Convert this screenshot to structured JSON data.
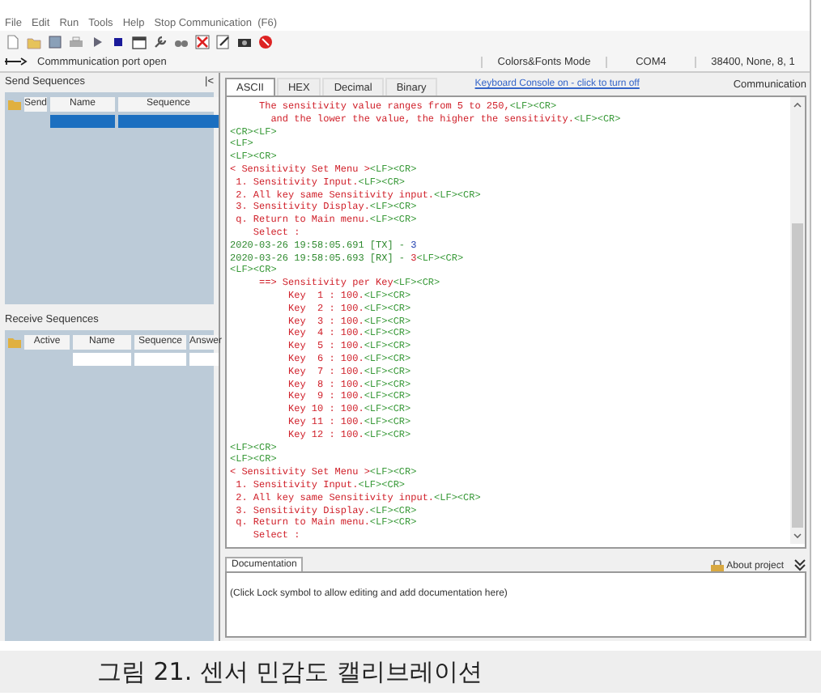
{
  "menu": [
    "File",
    "Edit",
    "Run",
    "Tools",
    "Help",
    "Stop Communication  (F6)"
  ],
  "status": {
    "port": "Commmunication port open",
    "mode": "Colors&Fonts Mode",
    "com": "COM4",
    "settings": "38400, None, 8, 1"
  },
  "send_sequences": {
    "title": "Send Sequences",
    "collapse": "|<",
    "columns": [
      "Send",
      "Name",
      "Sequence"
    ],
    "rows": [
      {
        "selected": true
      }
    ]
  },
  "receive_sequences": {
    "title": "Receive Sequences",
    "columns": [
      "Active",
      "Name",
      "Sequence",
      "Answer"
    ],
    "rows": [
      {
        "selected": false
      }
    ]
  },
  "console_tabs": [
    {
      "label": "ASCII",
      "selected": true
    },
    {
      "label": "HEX",
      "selected": false
    },
    {
      "label": "Decimal",
      "selected": false
    },
    {
      "label": "Binary",
      "selected": false
    }
  ],
  "keyboard_link": "Keyboard Console on - click to turn off",
  "panel_label": "Communication",
  "console_lines": [
    {
      "segments": [
        {
          "kind": "msg",
          "text": "     The sensitivity value ranges from 5 to 250,"
        },
        {
          "kind": "ctl",
          "text": "<LF><CR>"
        }
      ]
    },
    {
      "segments": [
        {
          "kind": "msg",
          "text": "       and the lower the value, the higher the sensitivity."
        },
        {
          "kind": "ctl",
          "text": "<LF><CR>"
        }
      ]
    },
    {
      "segments": [
        {
          "kind": "ctl",
          "text": "<CR><LF>"
        }
      ]
    },
    {
      "segments": [
        {
          "kind": "ctl",
          "text": "<LF>"
        }
      ]
    },
    {
      "segments": [
        {
          "kind": "ctl",
          "text": "<LF><CR>"
        }
      ]
    },
    {
      "segments": [
        {
          "kind": "msg",
          "text": "< Sensitivity Set Menu >"
        },
        {
          "kind": "ctl",
          "text": "<LF><CR>"
        }
      ]
    },
    {
      "segments": [
        {
          "kind": "msg",
          "text": " 1. Sensitivity Input."
        },
        {
          "kind": "ctl",
          "text": "<LF><CR>"
        }
      ]
    },
    {
      "segments": [
        {
          "kind": "msg",
          "text": " 2. All key same Sensitivity input."
        },
        {
          "kind": "ctl",
          "text": "<LF><CR>"
        }
      ]
    },
    {
      "segments": [
        {
          "kind": "msg",
          "text": " 3. Sensitivity Display."
        },
        {
          "kind": "ctl",
          "text": "<LF><CR>"
        }
      ]
    },
    {
      "segments": [
        {
          "kind": "msg",
          "text": " q. Return to Main menu."
        },
        {
          "kind": "ctl",
          "text": "<LF><CR>"
        }
      ]
    },
    {
      "segments": [
        {
          "kind": "msg",
          "text": "    Select :"
        }
      ]
    },
    {
      "segments": [
        {
          "kind": "ts",
          "text": "2020-03-26 19:58:05.691 [TX] - "
        },
        {
          "kind": "val",
          "text": "3"
        }
      ]
    },
    {
      "segments": [
        {
          "kind": "ts",
          "text": "2020-03-26 19:58:05.693 [RX] - "
        },
        {
          "kind": "msg",
          "text": "3"
        },
        {
          "kind": "ctl",
          "text": "<LF><CR>"
        }
      ]
    },
    {
      "segments": [
        {
          "kind": "ctl",
          "text": "<LF><CR>"
        }
      ]
    },
    {
      "segments": [
        {
          "kind": "msg",
          "text": "     ==> Sensitivity per Key"
        },
        {
          "kind": "ctl",
          "text": "<LF><CR>"
        }
      ]
    },
    {
      "segments": [
        {
          "kind": "msg",
          "text": "          Key  1 : 100."
        },
        {
          "kind": "ctl",
          "text": "<LF><CR>"
        }
      ]
    },
    {
      "segments": [
        {
          "kind": "msg",
          "text": "          Key  2 : 100."
        },
        {
          "kind": "ctl",
          "text": "<LF><CR>"
        }
      ]
    },
    {
      "segments": [
        {
          "kind": "msg",
          "text": "          Key  3 : 100."
        },
        {
          "kind": "ctl",
          "text": "<LF><CR>"
        }
      ]
    },
    {
      "segments": [
        {
          "kind": "msg",
          "text": "          Key  4 : 100."
        },
        {
          "kind": "ctl",
          "text": "<LF><CR>"
        }
      ]
    },
    {
      "segments": [
        {
          "kind": "msg",
          "text": "          Key  5 : 100."
        },
        {
          "kind": "ctl",
          "text": "<LF><CR>"
        }
      ]
    },
    {
      "segments": [
        {
          "kind": "msg",
          "text": "          Key  6 : 100."
        },
        {
          "kind": "ctl",
          "text": "<LF><CR>"
        }
      ]
    },
    {
      "segments": [
        {
          "kind": "msg",
          "text": "          Key  7 : 100."
        },
        {
          "kind": "ctl",
          "text": "<LF><CR>"
        }
      ]
    },
    {
      "segments": [
        {
          "kind": "msg",
          "text": "          Key  8 : 100."
        },
        {
          "kind": "ctl",
          "text": "<LF><CR>"
        }
      ]
    },
    {
      "segments": [
        {
          "kind": "msg",
          "text": "          Key  9 : 100."
        },
        {
          "kind": "ctl",
          "text": "<LF><CR>"
        }
      ]
    },
    {
      "segments": [
        {
          "kind": "msg",
          "text": "          Key 10 : 100."
        },
        {
          "kind": "ctl",
          "text": "<LF><CR>"
        }
      ]
    },
    {
      "segments": [
        {
          "kind": "msg",
          "text": "          Key 11 : 100."
        },
        {
          "kind": "ctl",
          "text": "<LF><CR>"
        }
      ]
    },
    {
      "segments": [
        {
          "kind": "msg",
          "text": "          Key 12 : 100."
        },
        {
          "kind": "ctl",
          "text": "<LF><CR>"
        }
      ]
    },
    {
      "segments": [
        {
          "kind": "ctl",
          "text": "<LF><CR>"
        }
      ]
    },
    {
      "segments": [
        {
          "kind": "ctl",
          "text": "<LF><CR>"
        }
      ]
    },
    {
      "segments": [
        {
          "kind": "msg",
          "text": "< Sensitivity Set Menu >"
        },
        {
          "kind": "ctl",
          "text": "<LF><CR>"
        }
      ]
    },
    {
      "segments": [
        {
          "kind": "msg",
          "text": " 1. Sensitivity Input."
        },
        {
          "kind": "ctl",
          "text": "<LF><CR>"
        }
      ]
    },
    {
      "segments": [
        {
          "kind": "msg",
          "text": " 2. All key same Sensitivity input."
        },
        {
          "kind": "ctl",
          "text": "<LF><CR>"
        }
      ]
    },
    {
      "segments": [
        {
          "kind": "msg",
          "text": " 3. Sensitivity Display."
        },
        {
          "kind": "ctl",
          "text": "<LF><CR>"
        }
      ]
    },
    {
      "segments": [
        {
          "kind": "msg",
          "text": " q. Return to Main menu."
        },
        {
          "kind": "ctl",
          "text": "<LF><CR>"
        }
      ]
    },
    {
      "segments": [
        {
          "kind": "msg",
          "text": "    Select :"
        }
      ]
    }
  ],
  "documentation_tab": "Documentation",
  "about_project": "About project",
  "documentation_text": "(Click Lock symbol to allow editing and add documentation here)",
  "caption": "그림 21. 센서 민감도 캘리브레이션"
}
